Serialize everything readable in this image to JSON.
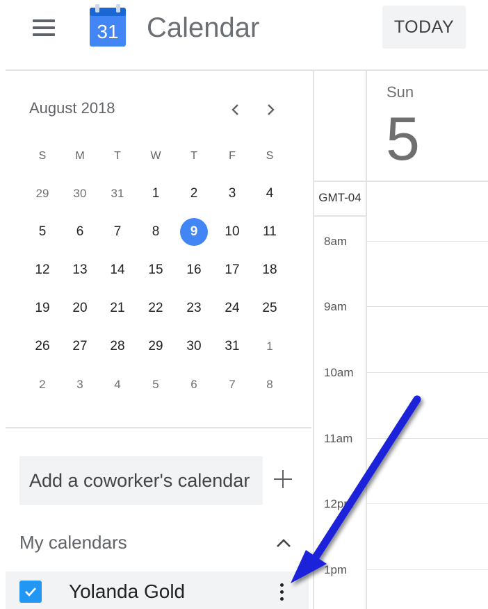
{
  "header": {
    "logo_day": "31",
    "app_title": "Calendar",
    "today_label": "TODAY"
  },
  "mini_calendar": {
    "month_label": "August 2018",
    "weekday_headers": [
      "S",
      "M",
      "T",
      "W",
      "T",
      "F",
      "S"
    ],
    "weeks": [
      [
        "29",
        "30",
        "31",
        "1",
        "2",
        "3",
        "4"
      ],
      [
        "5",
        "6",
        "7",
        "8",
        "9",
        "10",
        "11"
      ],
      [
        "12",
        "13",
        "14",
        "15",
        "16",
        "17",
        "18"
      ],
      [
        "19",
        "20",
        "21",
        "22",
        "23",
        "24",
        "25"
      ],
      [
        "26",
        "27",
        "28",
        "29",
        "30",
        "31",
        "1"
      ],
      [
        "2",
        "3",
        "4",
        "5",
        "6",
        "7",
        "8"
      ]
    ],
    "selected_day": "9"
  },
  "sidebar": {
    "coworker_placeholder": "Add a coworker's calendar",
    "my_calendars_label": "My calendars",
    "calendars": [
      {
        "name": "Yolanda Gold",
        "checked": true,
        "color": "#2196f3"
      }
    ]
  },
  "day_view": {
    "day_name": "Sun",
    "day_number": "5",
    "timezone": "GMT-04",
    "hours": [
      "8am",
      "9am",
      "10am",
      "11am",
      "12pm",
      "1pm"
    ]
  },
  "colors": {
    "accent": "#4285f4",
    "annotation_arrow": "#1a23d9"
  }
}
